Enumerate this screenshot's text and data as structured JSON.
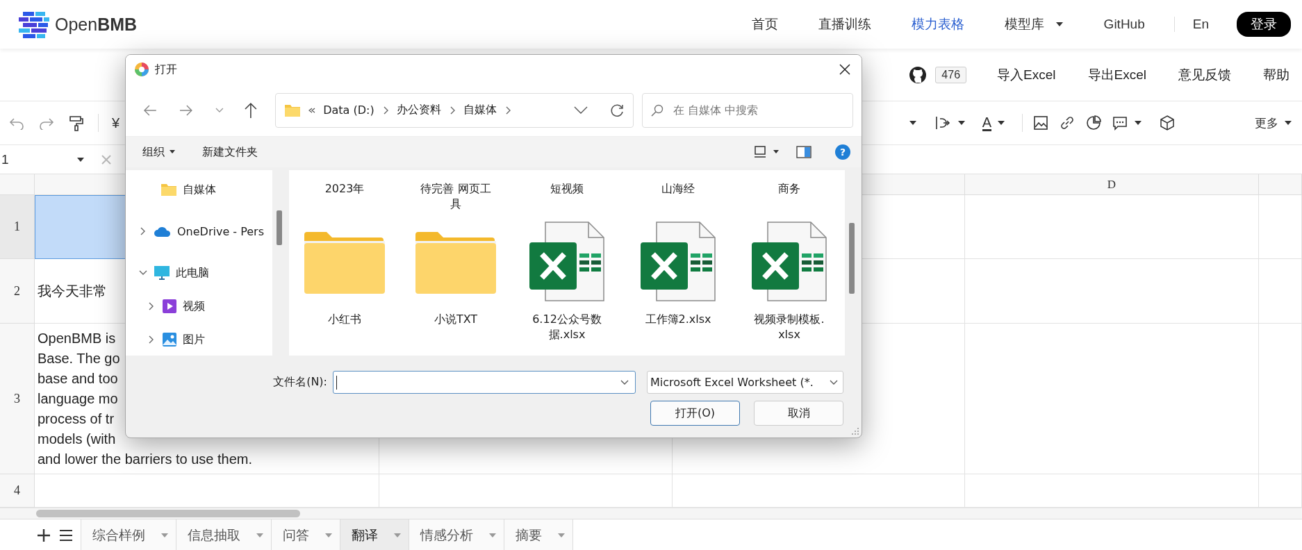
{
  "brand": "Open**BMB**",
  "nav": [
    {
      "label": "首页",
      "selected": false,
      "dropdown": false
    },
    {
      "label": "直播训练",
      "selected": false,
      "dropdown": false
    },
    {
      "label": "模力表格",
      "selected": true,
      "dropdown": false
    },
    {
      "label": "模型库",
      "selected": false,
      "dropdown": true
    },
    {
      "label": "GitHub",
      "selected": false,
      "dropdown": false
    }
  ],
  "language": "En",
  "login_button": "登录",
  "subbar": {
    "star_count": "476",
    "links": [
      "导入Excel",
      "导出Excel",
      "意见反馈",
      "帮助"
    ]
  },
  "toolbar": {
    "currency": "¥",
    "text_color": "A",
    "more": "更多"
  },
  "formula_bar": {
    "name_box": "1"
  },
  "sheet": {
    "column_header": "D",
    "rows": [
      {
        "number": "1",
        "selected": true
      },
      {
        "number": "2",
        "selected": false,
        "lines": [
          "我今天非常"
        ]
      },
      {
        "number": "3",
        "selected": false,
        "lines": [
          "OpenBMB is",
          "Base. The go",
          "base and too",
          "language mo",
          "process of tr",
          "models (with",
          "and lower the barriers to use them."
        ]
      },
      {
        "number": "4",
        "selected": false
      }
    ]
  },
  "sheet_tabs": [
    {
      "label": "综合样例",
      "selected": false
    },
    {
      "label": "信息抽取",
      "selected": false
    },
    {
      "label": "问答",
      "selected": false
    },
    {
      "label": "翻译",
      "selected": true
    },
    {
      "label": "情感分析",
      "selected": false
    },
    {
      "label": "摘要",
      "selected": false
    }
  ],
  "dialog": {
    "title": "打开",
    "path": [
      "Data (D:)",
      "办公资料",
      "自媒体"
    ],
    "search": {
      "placeholder": "在 自媒体 中搜索"
    },
    "organize": "组织",
    "new_folder": "新建文件夹",
    "help": "?",
    "nav_tree": [
      {
        "label": "自媒体",
        "kind": "folder"
      },
      {
        "label": "OneDrive - Pers",
        "kind": "cloud",
        "expanded": false
      },
      {
        "label": "此电脑",
        "kind": "computer",
        "expanded": true,
        "children": [
          {
            "label": "视频",
            "kind": "video",
            "expanded": false
          },
          {
            "label": "图片",
            "kind": "pictures",
            "expanded": false
          }
        ]
      }
    ],
    "partial_labels": [
      "2023年",
      "待完善 网页工具",
      "短视频",
      "山海经",
      "商务"
    ],
    "files": [
      {
        "name": "小红书",
        "kind": "folder"
      },
      {
        "name": "小说TXT",
        "kind": "folder"
      },
      {
        "name": "6.12公众号数据.xlsx",
        "kind": "excel"
      },
      {
        "name": "工作簿2.xlsx",
        "kind": "excel"
      },
      {
        "name": "视频录制模板.xlsx",
        "kind": "excel"
      }
    ],
    "filename_label": "文件名(N):",
    "file_type": "Microsoft Excel Worksheet (*.",
    "buttons": [
      {
        "label": "打开(O)",
        "default": true
      },
      {
        "label": "取消",
        "default": false
      }
    ]
  }
}
